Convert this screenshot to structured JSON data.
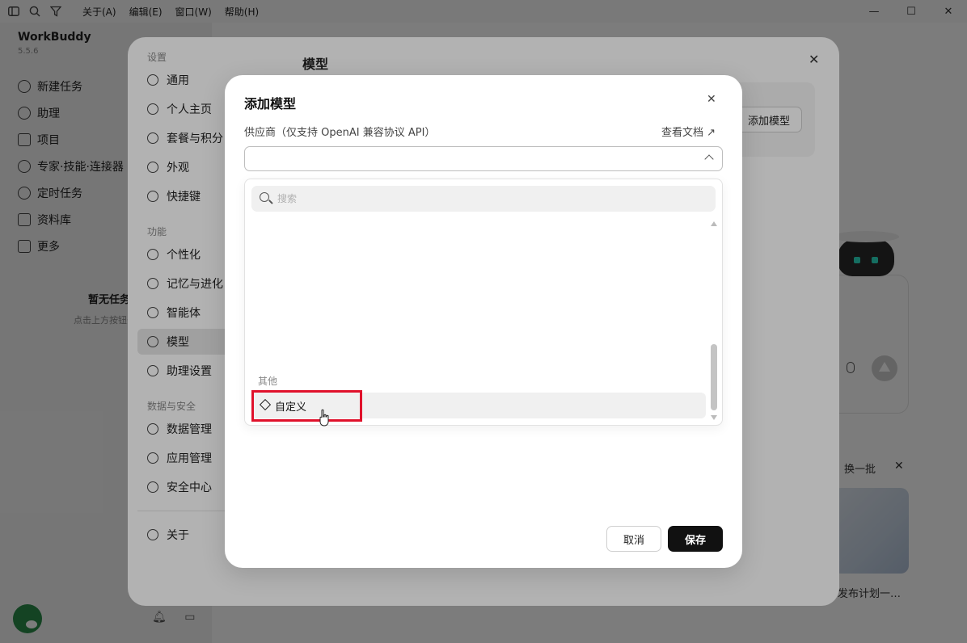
{
  "titlebar": {
    "menus": [
      "关于(A)",
      "编辑(E)",
      "窗口(W)",
      "帮助(H)"
    ],
    "icons": [
      "sidebar-toggle-icon",
      "search-icon",
      "filter-icon"
    ],
    "window_controls": [
      "minimize-icon",
      "maximize-icon",
      "close-icon"
    ]
  },
  "app": {
    "name": "WorkBuddy",
    "version": "5.5.6",
    "nav": [
      "新建任务",
      "助理",
      "项目",
      "专家·技能·连接器",
      "定时任务",
      "资料库",
      "更多"
    ],
    "empty_title": "暂无任务",
    "empty_subtitle": "点击上方按钮开始",
    "recommend_refresh": "换一批",
    "recommend_caption": "发布计划一…"
  },
  "settings": {
    "section_settings": "设置",
    "section_features": "功能",
    "section_data": "数据与安全",
    "items_settings": [
      "通用",
      "个人主页",
      "套餐与积分",
      "外观",
      "快捷键"
    ],
    "items_features": [
      "个性化",
      "记忆与进化",
      "智能体",
      "模型",
      "助理设置"
    ],
    "items_data": [
      "数据管理",
      "应用管理",
      "安全中心"
    ],
    "about": "关于",
    "active_item": "模型",
    "title": "模型",
    "add_model_button": "添加模型"
  },
  "dialog": {
    "title": "添加模型",
    "provider_label": "供应商（仅支持 OpenAI 兼容协议 API）",
    "docs_link": "查看文档 ↗",
    "select_value": "",
    "search_placeholder": "搜索",
    "group_label": "其他",
    "option_label": "自定义",
    "cancel": "取消",
    "save": "保存"
  },
  "colors": {
    "highlight": "#e0112b",
    "save_bg": "#111111",
    "dim_overlay": "rgba(0,0,0,0.30)"
  }
}
